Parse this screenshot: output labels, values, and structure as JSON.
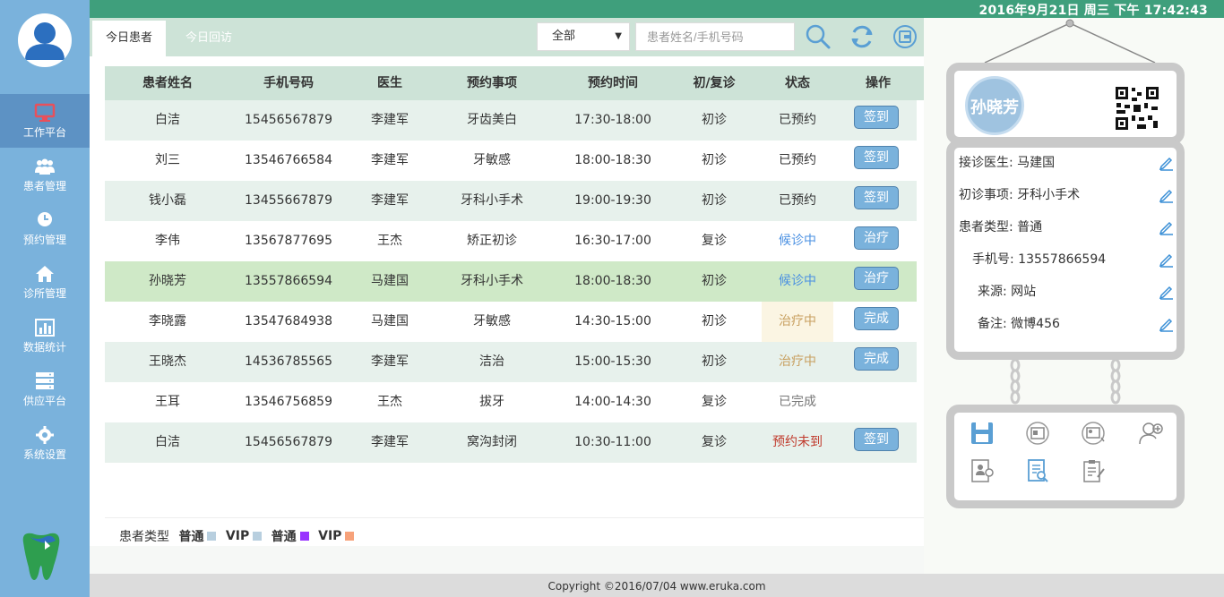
{
  "datetime": "2016年9月21日 周三 下午 17:42:43",
  "sidebar": {
    "items": [
      {
        "label": "工作平台",
        "icon": "monitor-icon"
      },
      {
        "label": "患者管理",
        "icon": "users-icon"
      },
      {
        "label": "预约管理",
        "icon": "clock-icon"
      },
      {
        "label": "诊所管理",
        "icon": "home-icon"
      },
      {
        "label": "数据统计",
        "icon": "bar-chart-icon"
      },
      {
        "label": "供应平台",
        "icon": "server-icon"
      },
      {
        "label": "系统设置",
        "icon": "gear-icon"
      }
    ]
  },
  "tabs": [
    {
      "label": "今日患者"
    },
    {
      "label": "今日回访"
    }
  ],
  "filter": {
    "selected": "全部",
    "search_placeholder": "患者姓名/手机号码"
  },
  "table": {
    "headers": [
      "患者姓名",
      "手机号码",
      "医生",
      "预约事项",
      "预约时间",
      "初/复诊",
      "状态",
      "操作"
    ],
    "rows": [
      {
        "name": "白洁",
        "phone": "15456567879",
        "doctor": "李建军",
        "item": "牙齿美白",
        "time": "17:30-18:00",
        "visit": "初诊",
        "status": "已预约",
        "action": "签到"
      },
      {
        "name": "刘三",
        "phone": "13546766584",
        "doctor": "李建军",
        "item": "牙敏感",
        "time": "18:00-18:30",
        "visit": "初诊",
        "status": "已预约",
        "action": "签到"
      },
      {
        "name": "钱小磊",
        "phone": "13455667879",
        "doctor": "李建军",
        "item": "牙科小手术",
        "time": "19:00-19:30",
        "visit": "初诊",
        "status": "已预约",
        "action": "签到"
      },
      {
        "name": "李伟",
        "phone": "13567877695",
        "doctor": "王杰",
        "item": "矫正初诊",
        "time": "16:30-17:00",
        "visit": "复诊",
        "status": "候诊中",
        "action": "治疗"
      },
      {
        "name": "孙晓芳",
        "phone": "13557866594",
        "doctor": "马建国",
        "item": "牙科小手术",
        "time": "18:00-18:30",
        "visit": "初诊",
        "status": "候诊中",
        "action": "治疗"
      },
      {
        "name": "李晓露",
        "phone": "13547684938",
        "doctor": "马建国",
        "item": "牙敏感",
        "time": "14:30-15:00",
        "visit": "初诊",
        "status": "治疗中",
        "action": "完成"
      },
      {
        "name": "王晓杰",
        "phone": "14536785565",
        "doctor": "李建军",
        "item": "洁治",
        "time": "15:00-15:30",
        "visit": "初诊",
        "status": "治疗中",
        "action": "完成"
      },
      {
        "name": "王耳",
        "phone": "13546756859",
        "doctor": "王杰",
        "item": "拔牙",
        "time": "14:00-14:30",
        "visit": "复诊",
        "status": "已完成",
        "action": ""
      },
      {
        "name": "白洁",
        "phone": "15456567879",
        "doctor": "李建军",
        "item": "窝沟封闭",
        "time": "10:30-11:00",
        "visit": "复诊",
        "status": "预约未到",
        "action": "签到"
      }
    ]
  },
  "legend": {
    "label": "患者类型",
    "items": [
      "普通",
      "VIP",
      "普通",
      "VIP"
    ],
    "colors": [
      "#b8cfdf",
      "#b8cfdf",
      "#9933ff",
      "#f7a27a"
    ]
  },
  "patient_card": {
    "name": "孙晓芳",
    "fields": [
      {
        "label": "接诊医生",
        "value": "马建国"
      },
      {
        "label": "初诊事项",
        "value": "牙科小手术"
      },
      {
        "label": "患者类型",
        "value": "普通"
      },
      {
        "label": "手机号",
        "value": "13557866594"
      },
      {
        "label": "来源",
        "value": "网站"
      },
      {
        "label": "备注",
        "value": "微博456"
      }
    ]
  },
  "footer": "Copyright ©2016/07/04 www.eruka.com",
  "colors": {
    "header_green": "#3f9f7c",
    "sidebar_blue": "#7ab2dc",
    "table_header": "#cde3d7",
    "selected_row": "#cfe9c7",
    "waiting": "#4a90e2",
    "treating": "#c8a060",
    "missed": "#c0392b"
  }
}
